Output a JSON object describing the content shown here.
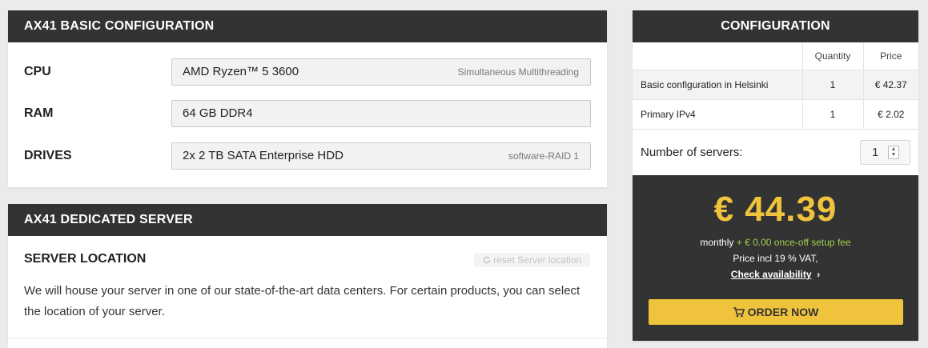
{
  "basic": {
    "title": "AX41 BASIC CONFIGURATION",
    "rows": [
      {
        "label": "CPU",
        "value": "AMD Ryzen™ 5 3600",
        "note": "Simultaneous Multithreading"
      },
      {
        "label": "RAM",
        "value": "64 GB DDR4",
        "note": ""
      },
      {
        "label": "DRIVES",
        "value": "2x 2 TB SATA Enterprise HDD",
        "note": "software-RAID 1"
      }
    ]
  },
  "dedicated": {
    "title": "AX41 DEDICATED SERVER",
    "location_title": "SERVER LOCATION",
    "reset_label": "reset Server location",
    "reset_icon": "refresh-icon",
    "description": "We will house your server in one of our state-of-the-art data centers. For certain products, you can select the location of your server."
  },
  "config": {
    "title": "CONFIGURATION",
    "columns": {
      "item": "",
      "quantity": "Quantity",
      "price": "Price"
    },
    "items": [
      {
        "name": "Basic configuration in Helsinki",
        "quantity": "1",
        "price": "€ 42.37"
      },
      {
        "name": "Primary IPv4",
        "quantity": "1",
        "price": "€ 2.02"
      }
    ],
    "servers_label": "Number of servers:",
    "servers_value": "1",
    "total": "€ 44.39",
    "monthly": "monthly",
    "setup_fee": "+ € 0.00 once-off setup fee",
    "vat": "Price incl 19 % VAT,",
    "availability": "Check availability",
    "order": "ORDER NOW",
    "order_icon": "cart-icon"
  },
  "colors": {
    "accent": "#f0c33c",
    "header": "#333333",
    "green": "#9ed04a"
  }
}
